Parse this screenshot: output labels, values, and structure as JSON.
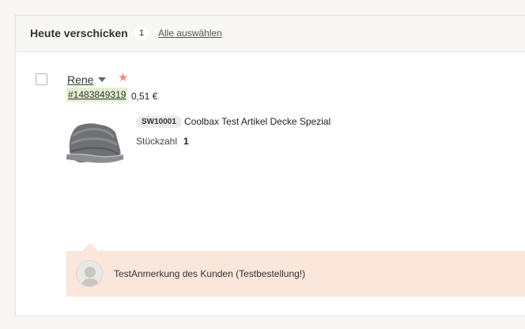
{
  "header": {
    "title": "Heute verschicken",
    "count": "1",
    "select_all": "Alle auswählen"
  },
  "order": {
    "customer": "Rene",
    "order_number": "#1483849319",
    "price": "0,51 €",
    "item": {
      "sku": "SW10001",
      "name": "Coolbax Test Artikel Decke Spezial",
      "quantity_label": "Stückzahl",
      "quantity": "1"
    },
    "note": "TestAnmerkung des Kunden (Testbestellung!)"
  },
  "icons": {
    "star": "star-icon",
    "caret": "caret-down-icon",
    "avatar": "user-avatar-icon"
  },
  "colors": {
    "order_highlight": "#e4efcf",
    "note_background": "#fae6db",
    "star": "#f08a7a"
  }
}
